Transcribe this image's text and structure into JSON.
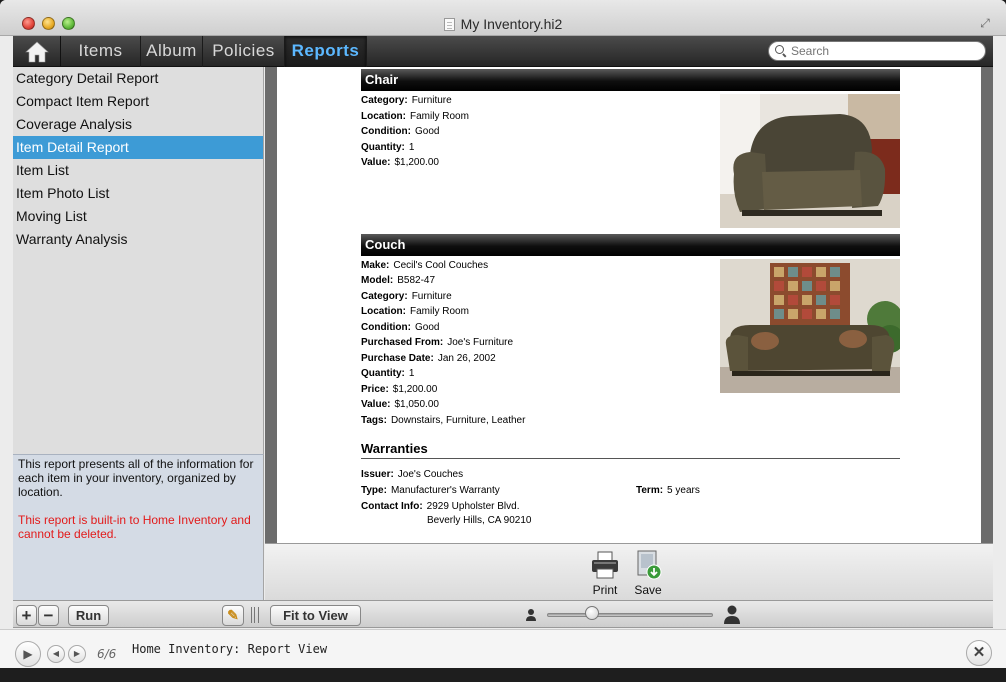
{
  "window": {
    "title": "My Inventory.hi2"
  },
  "tabs": [
    {
      "label": "Items"
    },
    {
      "label": "Album"
    },
    {
      "label": "Policies"
    },
    {
      "label": "Reports",
      "active": true
    }
  ],
  "search": {
    "placeholder": "Search",
    "value": ""
  },
  "sidebar": {
    "reports": [
      {
        "label": "Category Detail Report"
      },
      {
        "label": "Compact Item Report"
      },
      {
        "label": "Coverage Analysis"
      },
      {
        "label": "Item Detail Report",
        "selected": true
      },
      {
        "label": "Item List"
      },
      {
        "label": "Item Photo List"
      },
      {
        "label": "Moving List"
      },
      {
        "label": "Warranty Analysis"
      }
    ],
    "description": "This report presents all of the information for each item in your inventory, organized by location.",
    "warning": "This report is built-in to Home Inventory and cannot be deleted."
  },
  "report": {
    "chair": {
      "title": "Chair",
      "fields": [
        {
          "label": "Category:",
          "value": "Furniture"
        },
        {
          "label": "Location:",
          "value": "Family Room"
        },
        {
          "label": "Condition:",
          "value": "Good"
        },
        {
          "label": "Quantity:",
          "value": "1"
        },
        {
          "label": "Value:",
          "value": "$1,200.00"
        }
      ]
    },
    "couch": {
      "title": "Couch",
      "fields": [
        {
          "label": "Make:",
          "value": "Cecil's Cool Couches"
        },
        {
          "label": "Model:",
          "value": "B582-47"
        },
        {
          "label": "Category:",
          "value": "Furniture"
        },
        {
          "label": "Location:",
          "value": "Family Room"
        },
        {
          "label": "Condition:",
          "value": "Good"
        },
        {
          "label": "Purchased From:",
          "value": "Joe's Furniture"
        },
        {
          "label": "Purchase Date:",
          "value": "Jan 26, 2002"
        },
        {
          "label": "Quantity:",
          "value": "1"
        },
        {
          "label": "Price:",
          "value": "$1,200.00"
        },
        {
          "label": "Value:",
          "value": "$1,050.00"
        },
        {
          "label": "Tags:",
          "value": "Downstairs, Furniture, Leather"
        }
      ]
    },
    "warranties": {
      "title": "Warranties",
      "issuer_label": "Issuer:",
      "issuer": "Joe's Couches",
      "type_label": "Type:",
      "type": "Manufacturer's Warranty",
      "term_label": "Term:",
      "term": "5 years",
      "contact_label": "Contact Info:",
      "contact_line1": "2929 Upholster Blvd.",
      "contact_line2": "Beverly Hills, CA 90210"
    }
  },
  "actions": {
    "print": "Print",
    "save": "Save"
  },
  "bottom": {
    "run": "Run",
    "fit": "Fit to View",
    "zoom_level": 0.25
  },
  "status": {
    "counter": "6/6",
    "caption": "Home Inventory: Report View"
  },
  "colors": {
    "selection": "#3d9bd6",
    "active_tab": "#5cb8ff",
    "warning": "#e21a1a"
  }
}
